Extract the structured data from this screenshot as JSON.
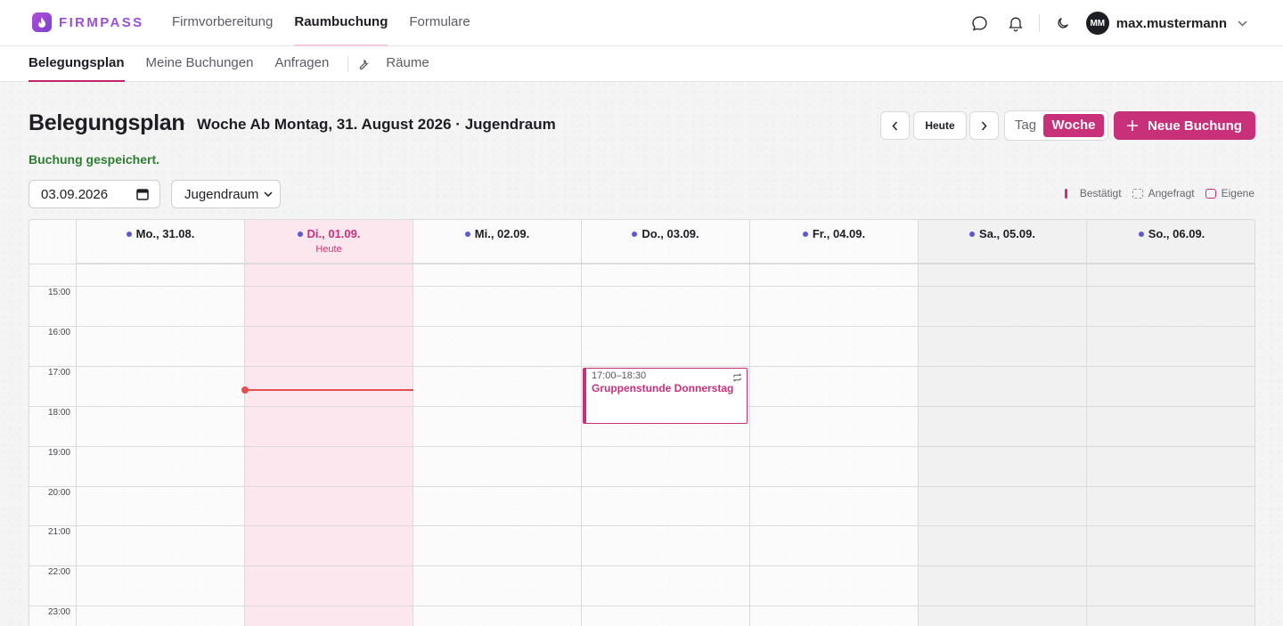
{
  "app": {
    "name": "FIRMPASS"
  },
  "main_nav": [
    {
      "label": "Firmvorbereitung",
      "active": false
    },
    {
      "label": "Raumbuchung",
      "active": true
    },
    {
      "label": "Formulare",
      "active": false
    }
  ],
  "user": {
    "initials": "MM",
    "name": "max.mustermann"
  },
  "sub_nav": {
    "items": [
      {
        "label": "Belegungsplan",
        "active": true
      },
      {
        "label": "Meine Buchungen",
        "active": false
      },
      {
        "label": "Anfragen",
        "active": false
      }
    ],
    "rooms_label": "Räume"
  },
  "header": {
    "title": "Belegungsplan",
    "separator": "·",
    "subtitle": "Woche Ab Montag, 31. August 2026 · Jugendraum",
    "status": "Buchung gespeichert."
  },
  "controls": {
    "today_label": "Heute",
    "view_day": "Tag",
    "view_week": "Woche",
    "new_booking": "Neue Buchung"
  },
  "filters": {
    "date_value": "03.09.2026",
    "room_value": "Jugendraum"
  },
  "legend": {
    "confirmed": "Bestätigt",
    "requested": "Angefragt",
    "own": "Eigene"
  },
  "calendar": {
    "days": [
      {
        "label": "Mo., 31.08.",
        "today": false,
        "weekend": false
      },
      {
        "label": "Di., 01.09.",
        "today": true,
        "weekend": false,
        "sub": "Heute"
      },
      {
        "label": "Mi., 02.09.",
        "today": false,
        "weekend": false
      },
      {
        "label": "Do., 03.09.",
        "today": false,
        "weekend": false
      },
      {
        "label": "Fr., 04.09.",
        "today": false,
        "weekend": false
      },
      {
        "label": "Sa., 05.09.",
        "today": false,
        "weekend": true
      },
      {
        "label": "So., 06.09.",
        "today": false,
        "weekend": true
      }
    ],
    "hours": [
      "15:00",
      "16:00",
      "17:00",
      "18:00",
      "19:00",
      "20:00",
      "21:00",
      "22:00",
      "23:00"
    ],
    "events": [
      {
        "time": "17:00–18:30",
        "title": "Gruppenstunde Donnerstag",
        "day": "Do., 03.09.",
        "recurring": true,
        "own": true
      }
    ]
  },
  "colors": {
    "accent": "#c9307a",
    "brand": "#9a4fd8",
    "success": "#2e7d32",
    "now_line": "#e35050",
    "day_dot": "#5a5ad8"
  }
}
